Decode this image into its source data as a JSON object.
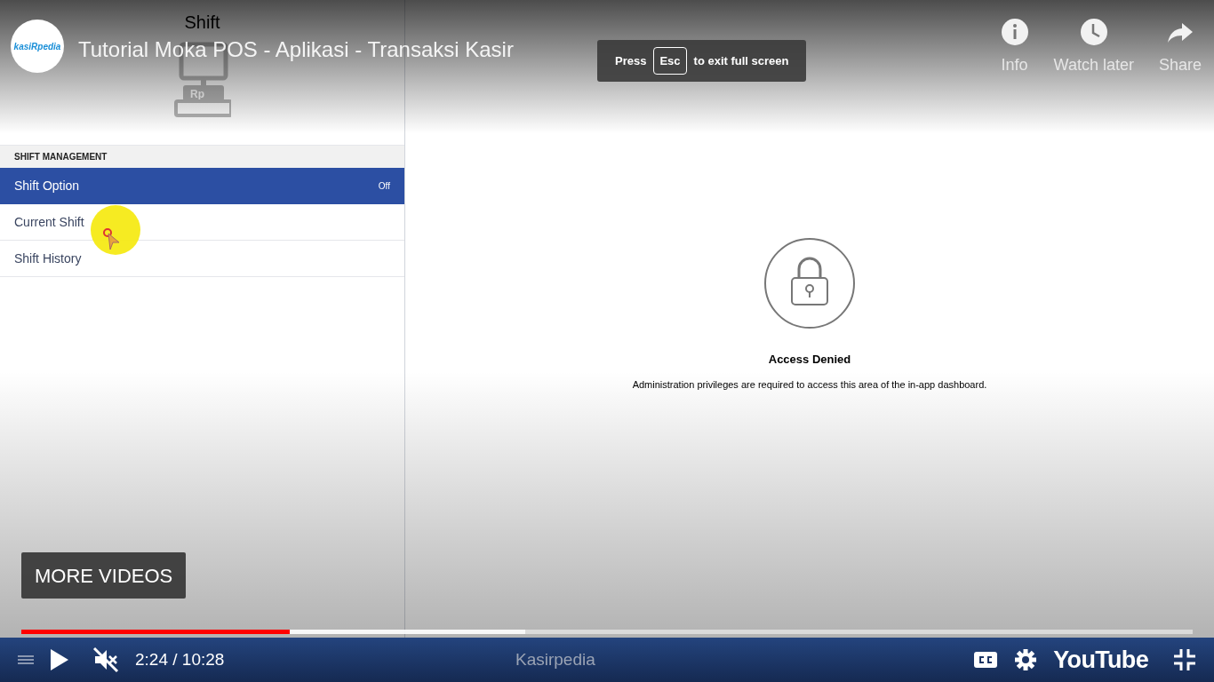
{
  "app": {
    "header": "Shift",
    "register_label": "Rp",
    "section": "SHIFT MANAGEMENT",
    "items": [
      {
        "label": "Shift Option",
        "value": "Off",
        "selected": true
      },
      {
        "label": "Current Shift",
        "selected": false
      },
      {
        "label": "Shift History",
        "selected": false
      }
    ],
    "notice": {
      "title": "Access Denied",
      "message": "Administration privileges are required to access this area of the in-app dashboard."
    }
  },
  "overlay": {
    "logo": "kasiRpedia",
    "title": "Tutorial Moka POS - Aplikasi - Transaksi Kasir",
    "actions": [
      {
        "kind": "info",
        "label": "Info"
      },
      {
        "kind": "clock",
        "label": "Watch later"
      },
      {
        "kind": "share",
        "label": "Share"
      }
    ],
    "toast": {
      "before": "Press",
      "key": "Esc",
      "after": "to exit full screen"
    },
    "more_videos": "MORE VIDEOS"
  },
  "player": {
    "progress": {
      "level": 0.229,
      "buffered": {
        "level": 0.43
      }
    },
    "muted": true,
    "time": "2:24 / 10:28",
    "channel": "Kasirpedia",
    "brand": "YouTube"
  }
}
